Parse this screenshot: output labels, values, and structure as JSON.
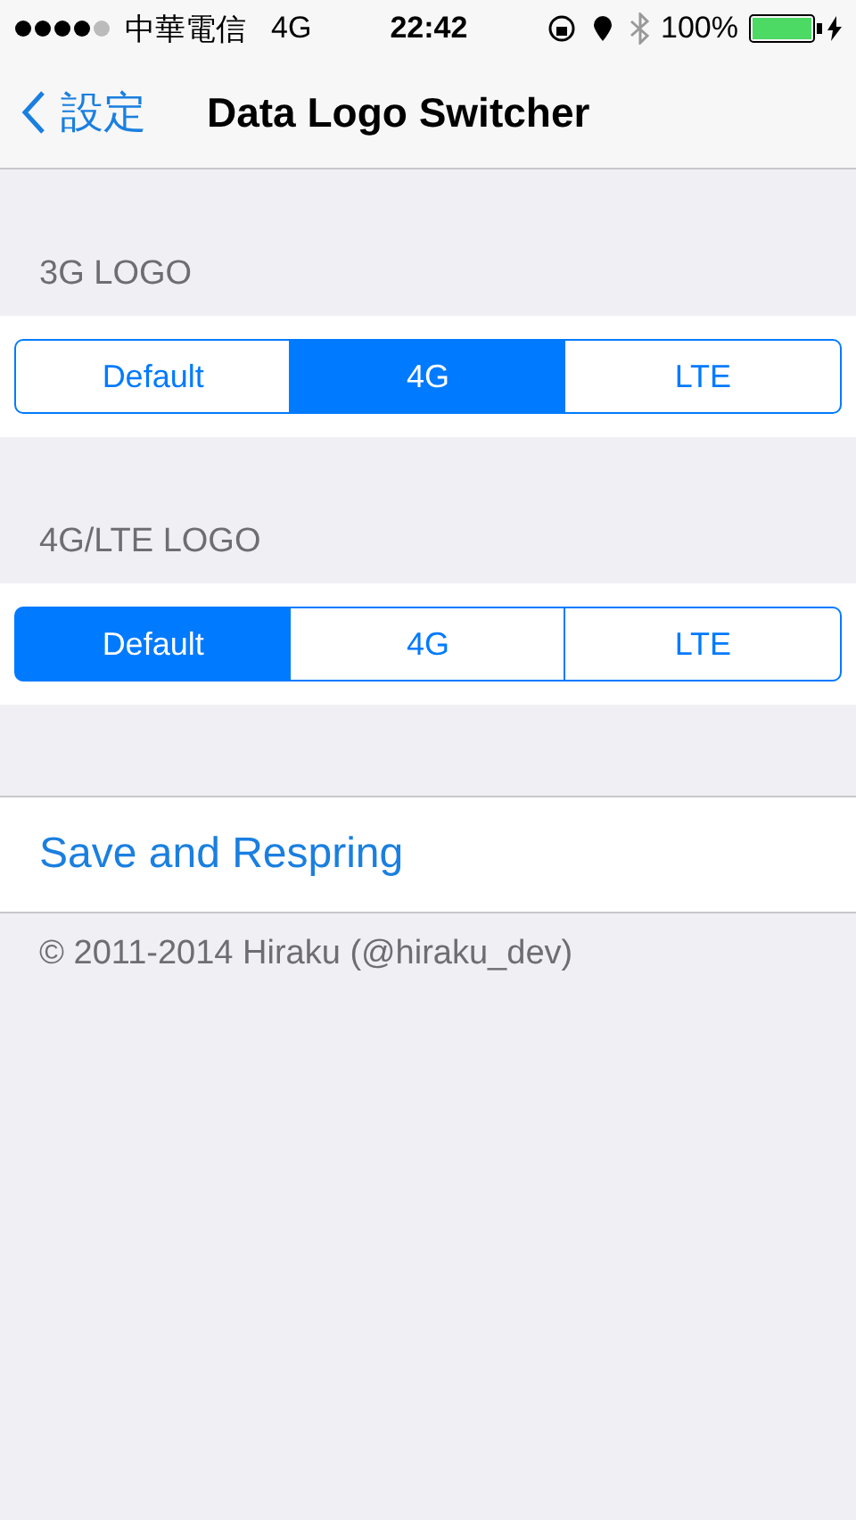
{
  "status_bar": {
    "carrier": "中華電信",
    "network": "4G",
    "time": "22:42",
    "battery": "100%"
  },
  "nav": {
    "back": "設定",
    "title": "Data Logo Switcher"
  },
  "sections": [
    {
      "header": "3G LOGO",
      "options": [
        {
          "label": "Default",
          "selected": false
        },
        {
          "label": "4G",
          "selected": true
        },
        {
          "label": "LTE",
          "selected": false
        }
      ]
    },
    {
      "header": "4G/LTE LOGO",
      "options": [
        {
          "label": "Default",
          "selected": true
        },
        {
          "label": "4G",
          "selected": false
        },
        {
          "label": "LTE",
          "selected": false
        }
      ]
    }
  ],
  "action": "Save and Respring",
  "footer": "© 2011-2014 Hiraku (@hiraku_dev)"
}
